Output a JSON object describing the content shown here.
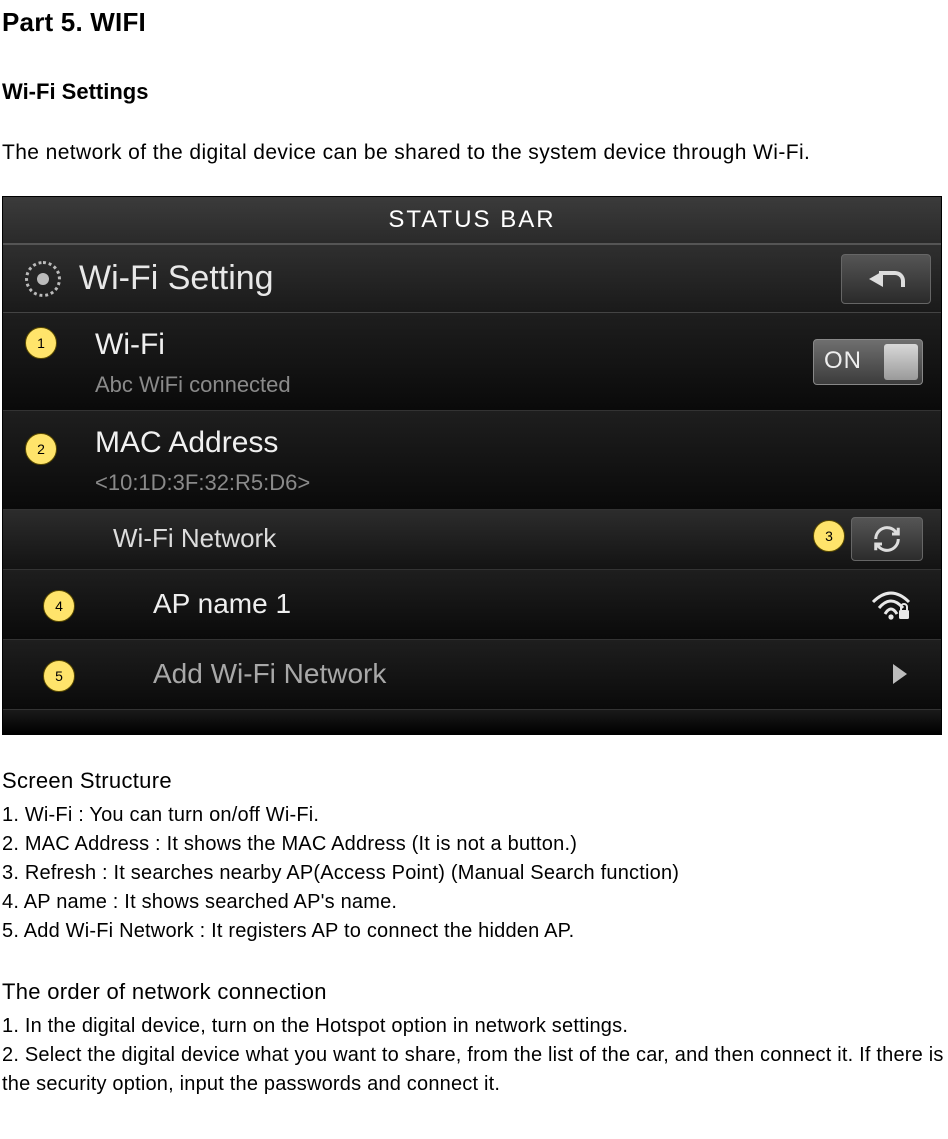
{
  "doc": {
    "part_title": "Part 5. WIFI",
    "section_title": "Wi-Fi Settings",
    "intro": "The network of the digital device can be shared to the system device through Wi-Fi."
  },
  "screen": {
    "status_bar": "STATUS BAR",
    "header": "Wi-Fi Setting",
    "wifi": {
      "title": "Wi-Fi",
      "subtitle": "Abc WiFi connected",
      "toggle": "ON"
    },
    "mac": {
      "title": "MAC Address",
      "value": "<10:1D:3F:32:R5:D6>"
    },
    "network_header": "Wi-Fi Network",
    "ap1": "AP name 1",
    "add": "Add Wi-Fi Network",
    "callouts": {
      "c1": "1",
      "c2": "2",
      "c3": "3",
      "c4": "4",
      "c5": "5"
    }
  },
  "structure": {
    "heading": "Screen Structure",
    "items": [
      "1. Wi-Fi : You can turn on/off Wi-Fi.",
      "2. MAC Address : It shows the MAC Address (It is not a button.)",
      "3. Refresh : It searches nearby AP(Access Point) (Manual Search function)",
      "4. AP name : It shows searched AP's name.",
      "5. Add Wi-Fi Network : It registers AP to connect the hidden AP."
    ]
  },
  "order": {
    "heading": "The order of network connection",
    "items": [
      "1. In the digital device, turn on the Hotspot option in network settings.",
      "2. Select the digital device what you want to share, from the list of the car, and then connect it. If there is the security option, input the passwords and connect it."
    ]
  }
}
